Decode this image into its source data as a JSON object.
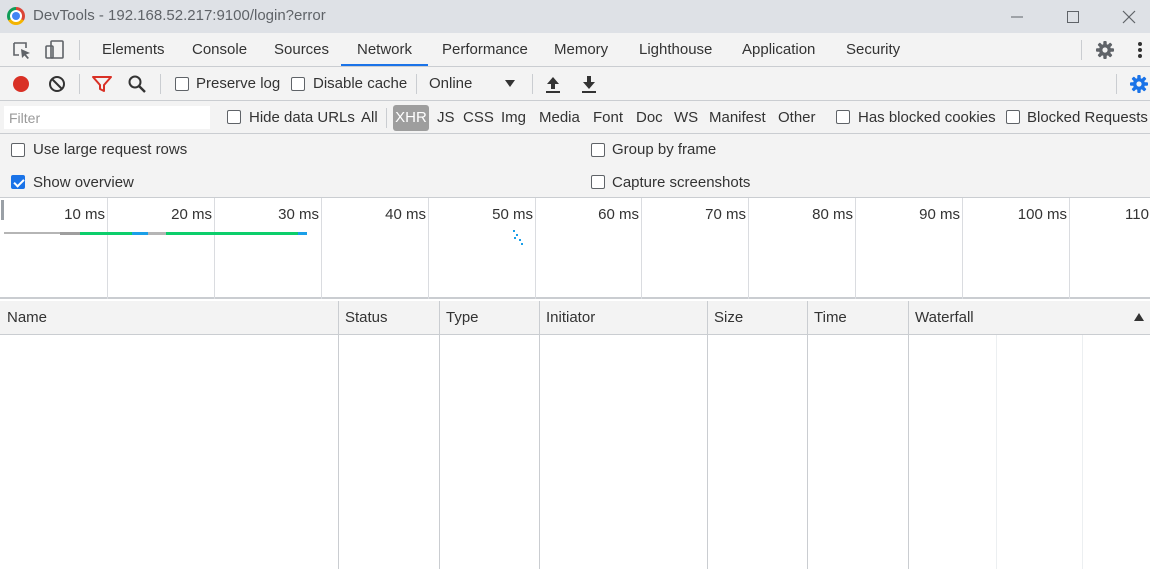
{
  "window": {
    "title": "DevTools - 192.168.52.217:9100/login?error"
  },
  "tabs": [
    {
      "label": "Elements"
    },
    {
      "label": "Console"
    },
    {
      "label": "Sources"
    },
    {
      "label": "Network",
      "active": true
    },
    {
      "label": "Performance"
    },
    {
      "label": "Memory"
    },
    {
      "label": "Lighthouse"
    },
    {
      "label": "Application"
    },
    {
      "label": "Security"
    }
  ],
  "toolbar": {
    "preserve_log": {
      "label": "Preserve log",
      "checked": false
    },
    "disable_cache": {
      "label": "Disable cache",
      "checked": false
    },
    "throttling": "Online"
  },
  "filterbar": {
    "placeholder": "Filter",
    "hide_data_urls": {
      "label": "Hide data URLs",
      "checked": false
    },
    "types": [
      "All",
      "XHR",
      "JS",
      "CSS",
      "Img",
      "Media",
      "Font",
      "Doc",
      "WS",
      "Manifest",
      "Other"
    ],
    "selected_type": "XHR",
    "has_blocked_cookies": {
      "label": "Has blocked cookies",
      "checked": false
    },
    "blocked_requests": {
      "label": "Blocked Requests",
      "checked": false
    }
  },
  "settings": {
    "large_rows": {
      "label": "Use large request rows",
      "checked": false
    },
    "show_overview": {
      "label": "Show overview",
      "checked": true
    },
    "group_by_frame": {
      "label": "Group by frame",
      "checked": false
    },
    "capture_screenshots": {
      "label": "Capture screenshots",
      "checked": false
    }
  },
  "overview": {
    "ticks": [
      "10 ms",
      "20 ms",
      "30 ms",
      "40 ms",
      "50 ms",
      "60 ms",
      "70 ms",
      "80 ms",
      "90 ms",
      "100 ms",
      "110"
    ]
  },
  "table": {
    "columns": [
      "Name",
      "Status",
      "Type",
      "Initiator",
      "Size",
      "Time",
      "Waterfall"
    ],
    "rows": []
  },
  "colors": {
    "accent": "#1a73e8",
    "record": "#d93025",
    "filter_active": "#d93025",
    "waterfall_green": "#0cce6b",
    "waterfall_blue": "#1a9fe8",
    "waterfall_gray": "#b5b5b5"
  }
}
